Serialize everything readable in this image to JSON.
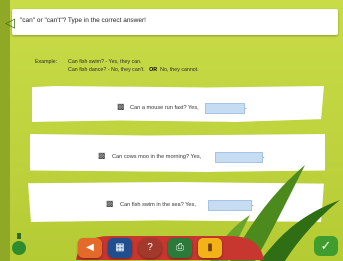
{
  "instruction": {
    "text": "\"can\" or \"can't\"? Type in the correct answer!"
  },
  "example": {
    "label": "Example:",
    "line1": "Can fish swim? - Yes, they can.",
    "line2a": "Can fish dance? - No, they can't.",
    "or_word": "OR",
    "line2b": "No, they cannot."
  },
  "questions": [
    {
      "prompt": "Can a mouse run fast? Yes,",
      "value": "",
      "suffix": "."
    },
    {
      "prompt": "Can cows moo in the morning? Yes,",
      "value": "",
      "suffix": "."
    },
    {
      "prompt": "Can fish swim in the sea? Yes,",
      "value": "",
      "suffix": "."
    }
  ],
  "icons": {
    "back": "back-arrow-icon",
    "speaker": "speaker-icon",
    "ok": "checkmark-icon",
    "toolbar": [
      "exit-icon",
      "keyboard-icon",
      "help-icon",
      "print-icon",
      "results-icon"
    ]
  },
  "colors": {
    "background": "#b9cf3a",
    "answer_box": "#c6dcf3",
    "ok_button": "#3f9d2e"
  }
}
